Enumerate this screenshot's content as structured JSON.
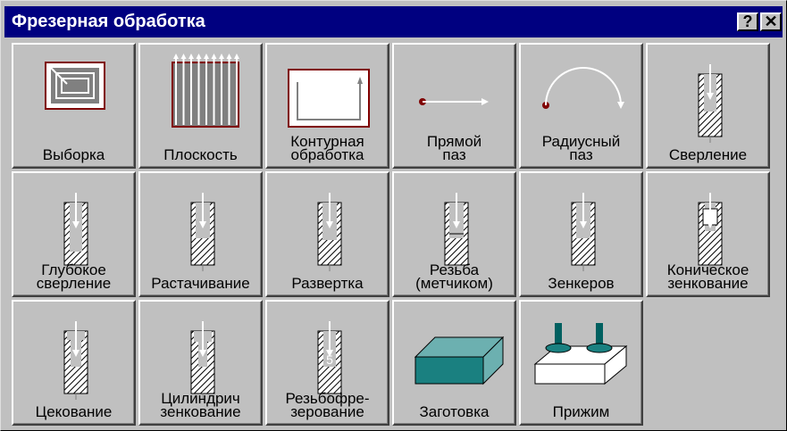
{
  "window": {
    "title": "Фрезерная обработка"
  },
  "titlebar_buttons": {
    "help": "?",
    "close": "✕"
  },
  "tools": [
    {
      "name": "tool-vyborka",
      "label": "Выборка",
      "icon": "pocket-icon"
    },
    {
      "name": "tool-ploskost",
      "label": "Плоскость",
      "icon": "plane-icon"
    },
    {
      "name": "tool-konturnaya",
      "label": "Контурная\nобработка",
      "icon": "contour-icon"
    },
    {
      "name": "tool-pryamoy-paz",
      "label": "Прямой\nпаз",
      "icon": "straight-slot-icon"
    },
    {
      "name": "tool-radiusny-paz",
      "label": "Радиусный\nпаз",
      "icon": "radius-slot-icon"
    },
    {
      "name": "tool-sverlenie",
      "label": "Сверление",
      "icon": "drilling-icon"
    },
    {
      "name": "tool-glubokoe-sverlenie",
      "label": "Глубокое\nсверление",
      "icon": "deep-drilling-icon"
    },
    {
      "name": "tool-rastachivanie",
      "label": "Растачивание",
      "icon": "boring-icon"
    },
    {
      "name": "tool-razvertka",
      "label": "Развертка",
      "icon": "reaming-icon"
    },
    {
      "name": "tool-rezba",
      "label": "Резьба\n(метчиком)",
      "icon": "tapping-icon"
    },
    {
      "name": "tool-zenkerov",
      "label": "Зенкеров",
      "icon": "countersink-drill-icon"
    },
    {
      "name": "tool-konicheskoe",
      "label": "Коническое\nзенкование",
      "icon": "conical-countersink-icon"
    },
    {
      "name": "tool-tsekovanie",
      "label": "Цекование",
      "icon": "spot-facing-icon"
    },
    {
      "name": "tool-tsilindrich",
      "label": "Цилиндрич\nзенкование",
      "icon": "cylindrical-countersink-icon"
    },
    {
      "name": "tool-rezbofrezerovanie",
      "label": "Резьбофре-\nзерование",
      "icon": "thread-milling-icon"
    },
    {
      "name": "tool-zagotovka",
      "label": "Заготовка",
      "icon": "blank-icon"
    },
    {
      "name": "tool-prizhim",
      "label": "Прижим",
      "icon": "clamp-icon"
    }
  ]
}
